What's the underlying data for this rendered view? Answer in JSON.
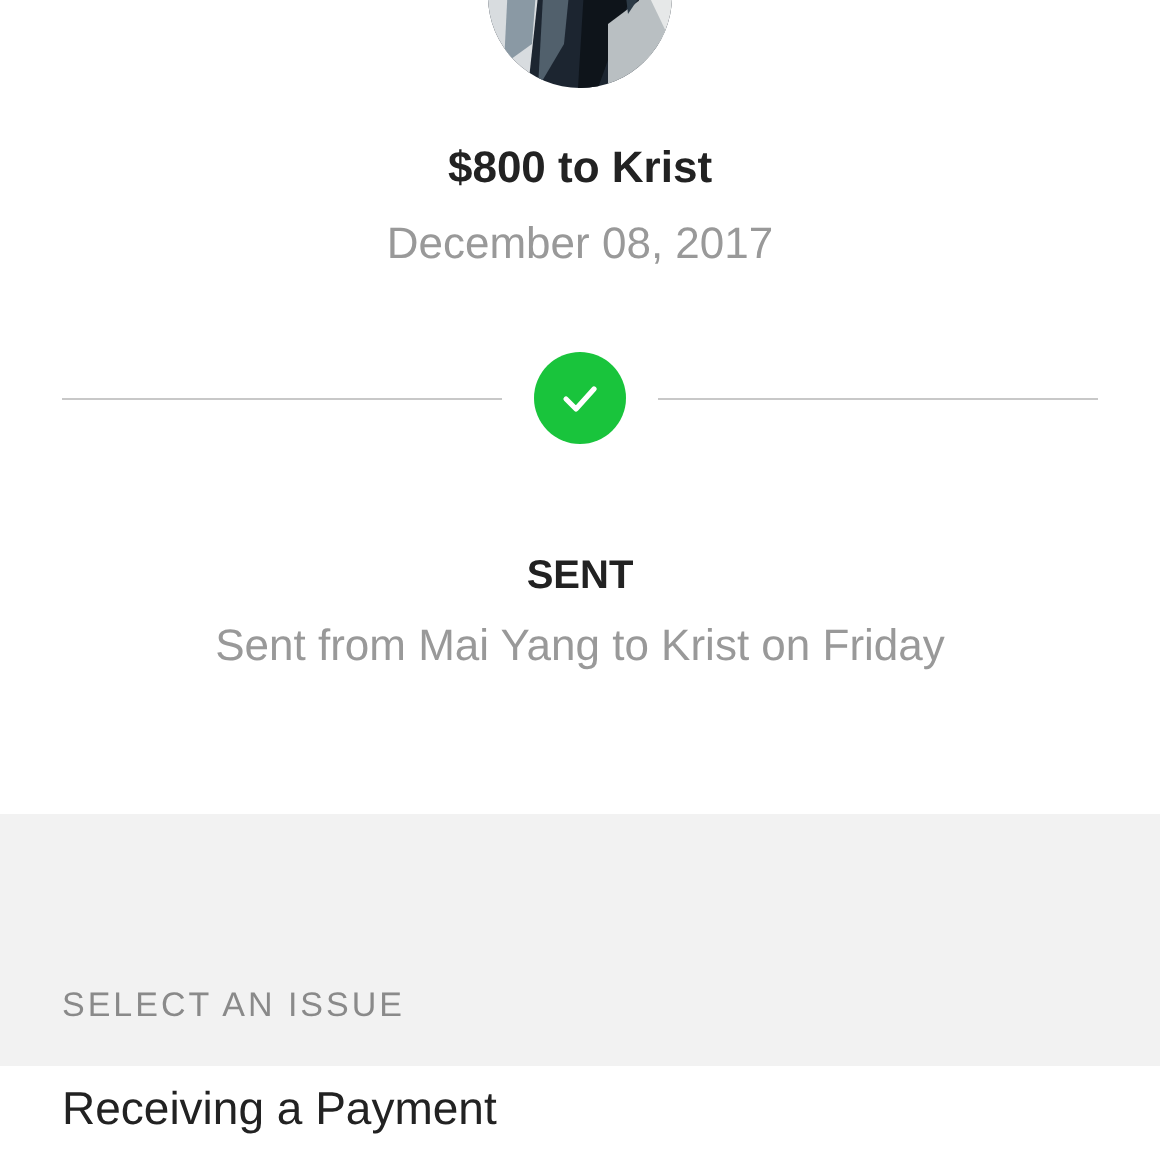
{
  "payment": {
    "title": "$800 to Krist",
    "date": "December 08, 2017"
  },
  "status": {
    "kind": "sent",
    "label": "SENT",
    "detail": "Sent from Mai Yang to Krist on Friday"
  },
  "issues": {
    "header": "SELECT AN ISSUE",
    "items": [
      {
        "label": "Receiving a Payment"
      }
    ]
  }
}
